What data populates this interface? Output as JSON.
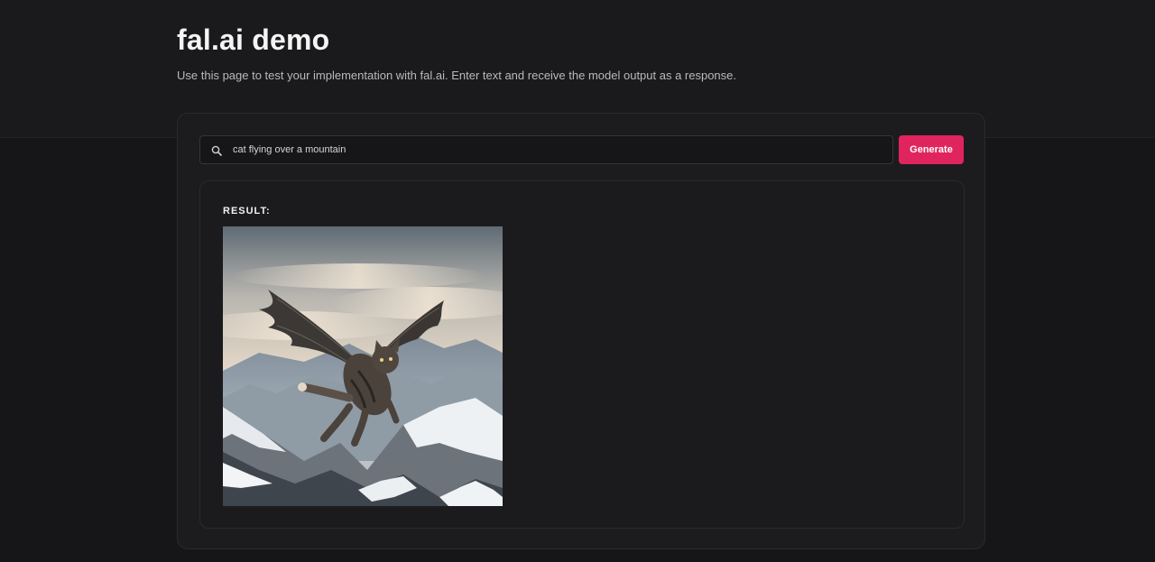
{
  "header": {
    "title": "fal.ai demo",
    "description": "Use this page to test your implementation with fal.ai. Enter text and receive the model output as a response."
  },
  "search": {
    "value": "cat flying over a mountain",
    "icon": "search-icon"
  },
  "generate_button": {
    "label": "Generate",
    "color": "#e0245e"
  },
  "result": {
    "label": "RESULT:",
    "image_alt": "cat with wings flying over snowy mountains"
  }
}
